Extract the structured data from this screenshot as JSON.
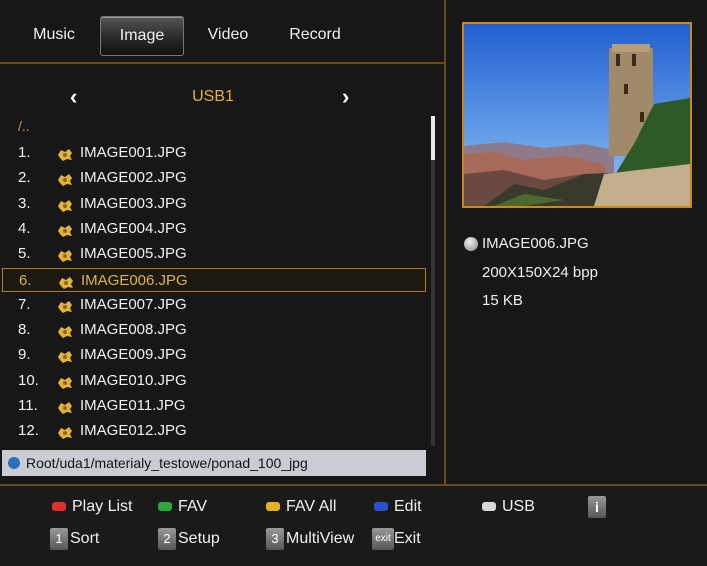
{
  "tabs": [
    {
      "label": "Music"
    },
    {
      "label": "Image"
    },
    {
      "label": "Video"
    },
    {
      "label": "Record"
    }
  ],
  "active_tab": "Image",
  "nav": {
    "prev": "‹",
    "next": "›",
    "device": "USB1"
  },
  "parent_dir": "/..",
  "files": [
    {
      "num": "1.",
      "name": "IMAGE001.JPG"
    },
    {
      "num": "2.",
      "name": "IMAGE002.JPG"
    },
    {
      "num": "3.",
      "name": "IMAGE003.JPG"
    },
    {
      "num": "4.",
      "name": "IMAGE004.JPG"
    },
    {
      "num": "5.",
      "name": "IMAGE005.JPG"
    },
    {
      "num": "6.",
      "name": "IMAGE006.JPG"
    },
    {
      "num": "7.",
      "name": "IMAGE007.JPG"
    },
    {
      "num": "8.",
      "name": "IMAGE008.JPG"
    },
    {
      "num": "9.",
      "name": "IMAGE009.JPG"
    },
    {
      "num": "10.",
      "name": "IMAGE010.JPG"
    },
    {
      "num": "11.",
      "name": "IMAGE011.JPG"
    },
    {
      "num": "12.",
      "name": "IMAGE012.JPG"
    }
  ],
  "selected_index": 5,
  "path": "Root/uda1/materialy_testowe/ponad_100_jpg",
  "preview": {
    "filename": "IMAGE006.JPG",
    "resolution": "200X150X24 bpp",
    "size": "15 KB"
  },
  "legend": {
    "play_list": {
      "label": "Play List",
      "color": "#e0302a"
    },
    "fav": {
      "label": "FAV",
      "color": "#2aa838"
    },
    "fav_all": {
      "label": "FAV All",
      "color": "#e6b020"
    },
    "edit": {
      "label": "Edit",
      "color": "#2a4fd0"
    },
    "usb": {
      "label": "USB",
      "color": "#d8d8d8"
    },
    "info_key": "i",
    "sort": {
      "key": "1",
      "label": "Sort"
    },
    "setup": {
      "key": "2",
      "label": "Setup"
    },
    "multiview": {
      "key": "3",
      "label": "MultiView"
    },
    "exit": {
      "key": "exit",
      "label": "Exit"
    }
  },
  "colors": {
    "accent": "#e2b23a",
    "border": "#c68a22"
  }
}
